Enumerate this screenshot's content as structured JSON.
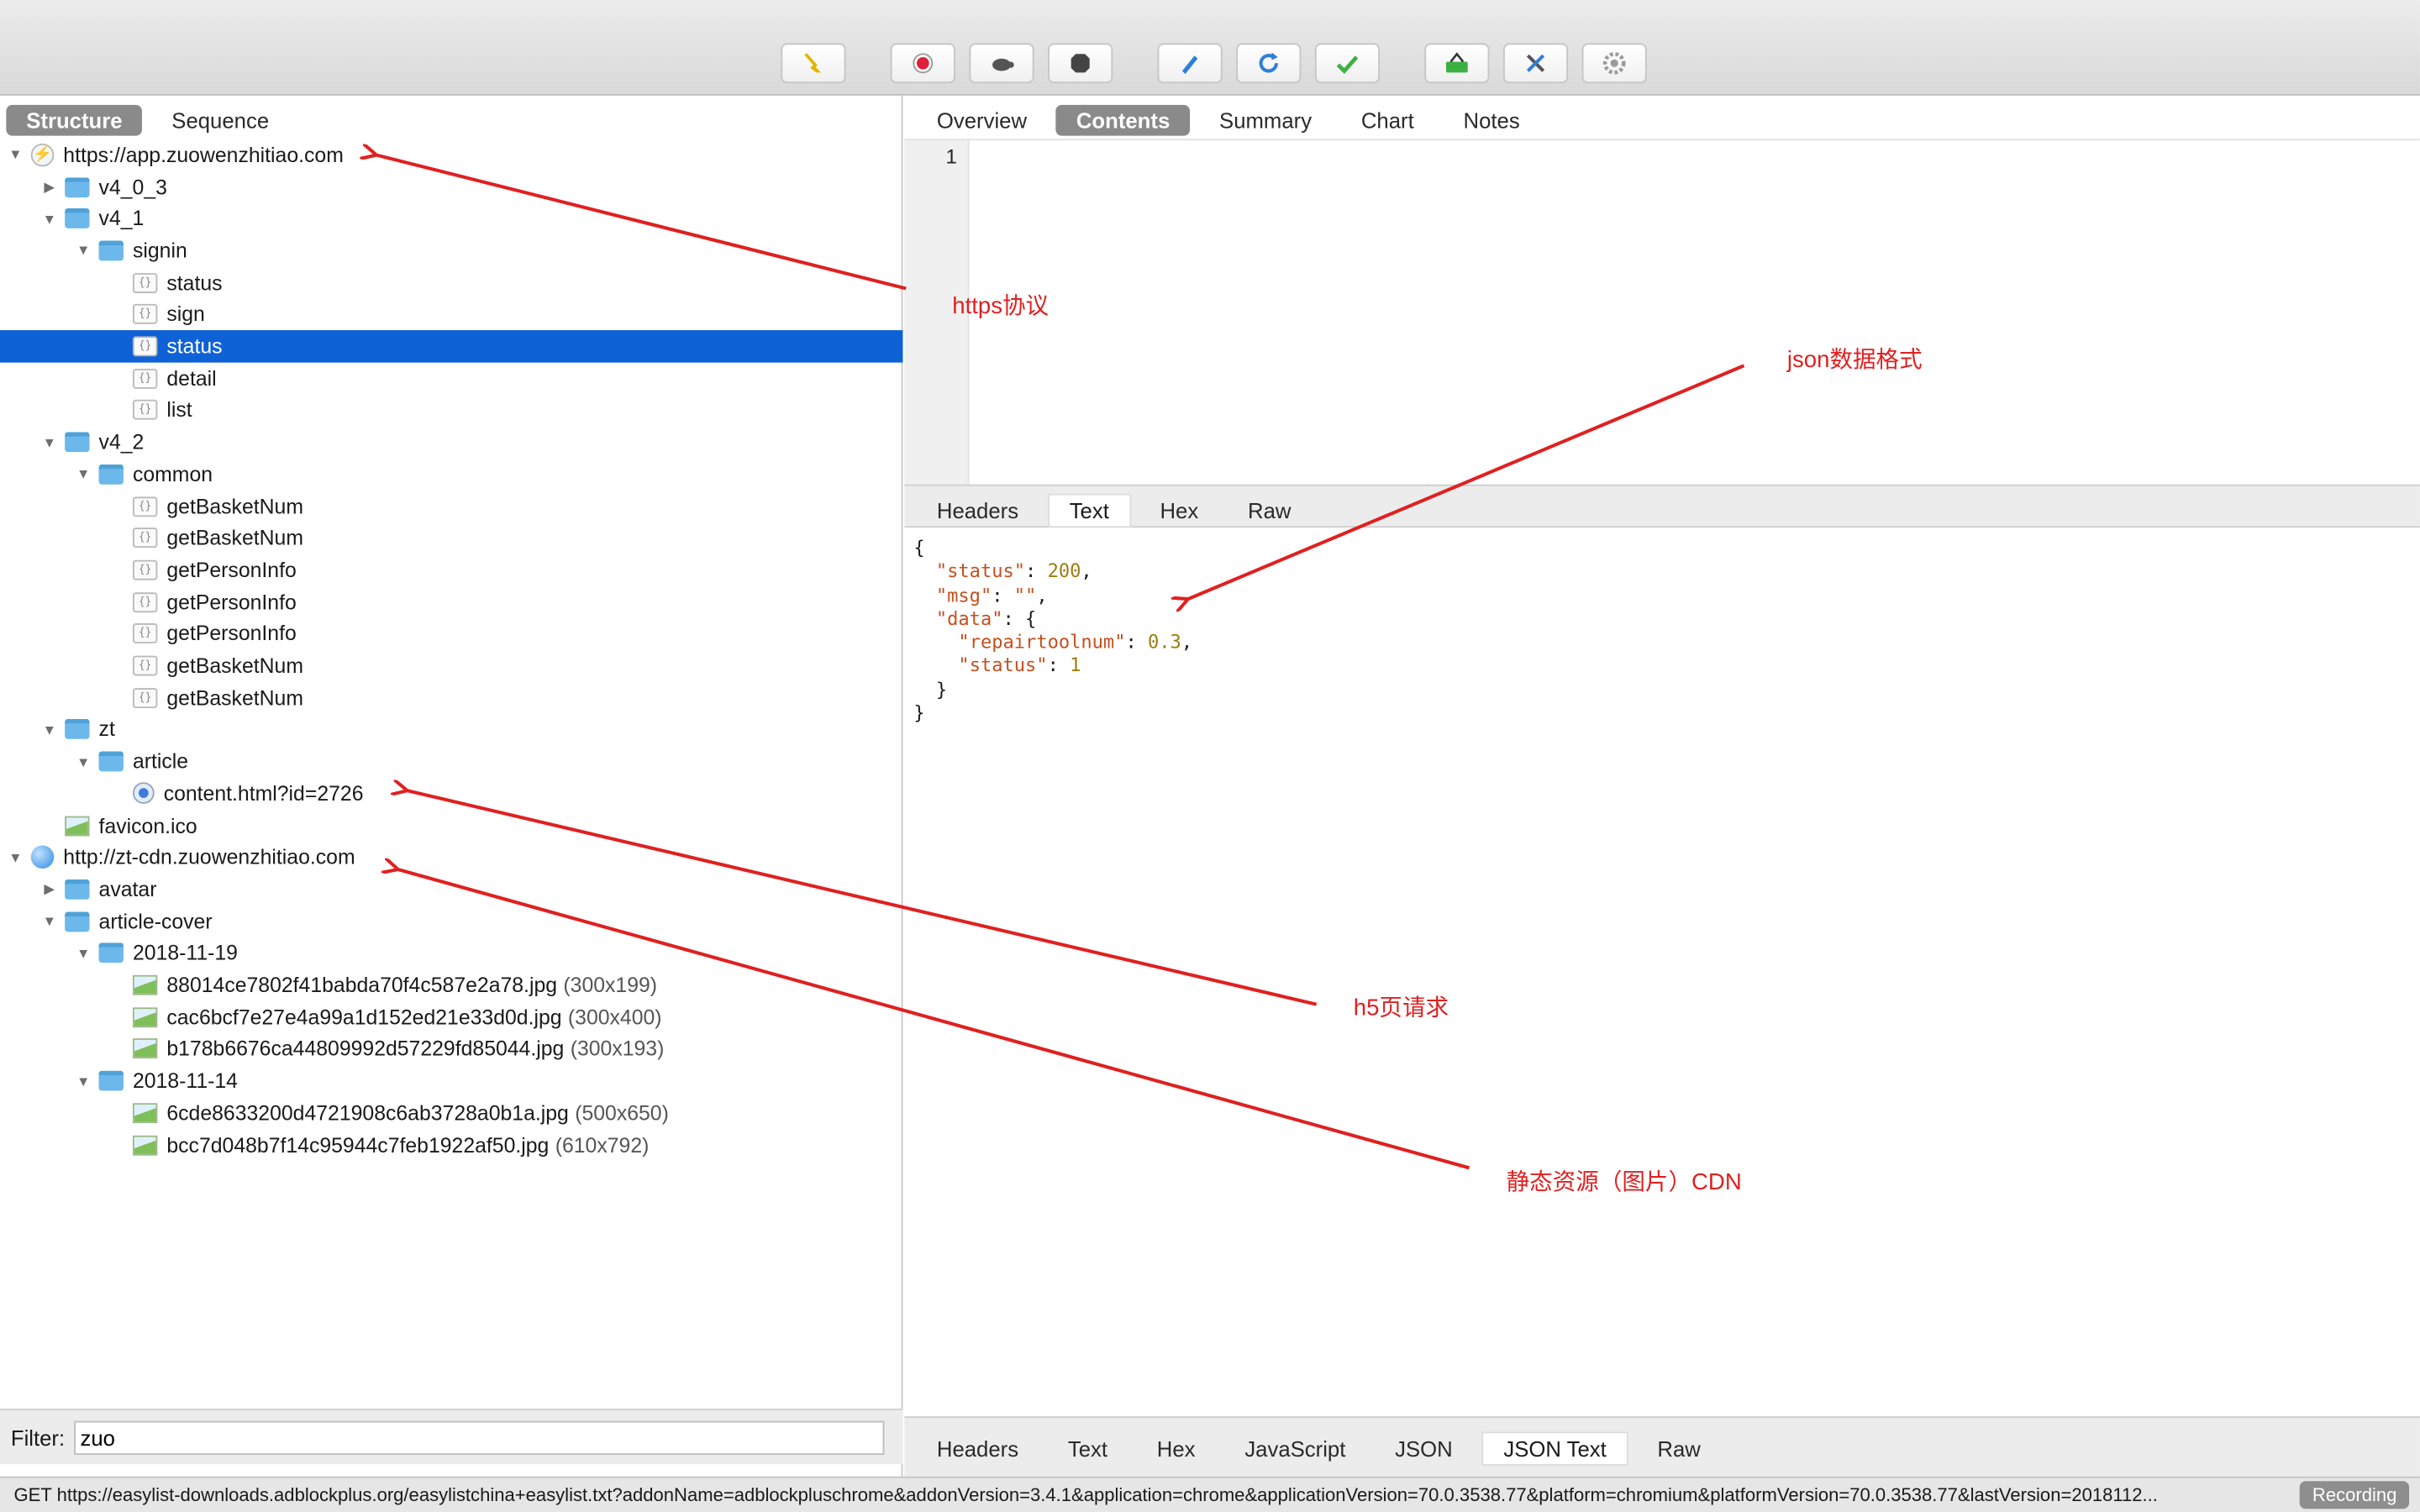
{
  "toolbar": {
    "buttons": [
      {
        "name": "broom-icon",
        "color": "#e0b400"
      },
      {
        "name": "record-icon",
        "color": "#e0203a"
      },
      {
        "name": "turtle-icon",
        "color": "#555555"
      },
      {
        "name": "stop-icon",
        "color": "#444444"
      },
      {
        "name": "pen-icon",
        "color": "#2f7fd8"
      },
      {
        "name": "refresh-icon",
        "color": "#2f7fd8"
      },
      {
        "name": "check-icon",
        "color": "#3cb043"
      },
      {
        "name": "basket-icon",
        "color": "#3cb043"
      },
      {
        "name": "tools-icon",
        "color": "#2f7fd8"
      },
      {
        "name": "gear-icon",
        "color": "#9a9a9a"
      }
    ]
  },
  "left_tabs": [
    "Structure",
    "Sequence"
  ],
  "tree": [
    {
      "depth": 0,
      "disc": "open",
      "icon": "host-https",
      "label": "https://app.zuowenzhitiao.com"
    },
    {
      "depth": 1,
      "disc": "closed",
      "icon": "folder",
      "label": "v4_0_3"
    },
    {
      "depth": 1,
      "disc": "open",
      "icon": "folder",
      "label": "v4_1"
    },
    {
      "depth": 2,
      "disc": "open",
      "icon": "folder",
      "label": "signin"
    },
    {
      "depth": 3,
      "disc": "none",
      "icon": "json",
      "label": "status"
    },
    {
      "depth": 3,
      "disc": "none",
      "icon": "json",
      "label": "sign"
    },
    {
      "depth": 3,
      "disc": "none",
      "icon": "json",
      "label": "status",
      "selected": true
    },
    {
      "depth": 3,
      "disc": "none",
      "icon": "json",
      "label": "detail"
    },
    {
      "depth": 3,
      "disc": "none",
      "icon": "json",
      "label": "list"
    },
    {
      "depth": 1,
      "disc": "open",
      "icon": "folder",
      "label": "v4_2"
    },
    {
      "depth": 2,
      "disc": "open",
      "icon": "folder",
      "label": "common"
    },
    {
      "depth": 3,
      "disc": "none",
      "icon": "json",
      "label": "getBasketNum"
    },
    {
      "depth": 3,
      "disc": "none",
      "icon": "json",
      "label": "getBasketNum"
    },
    {
      "depth": 3,
      "disc": "none",
      "icon": "json",
      "label": "getPersonInfo"
    },
    {
      "depth": 3,
      "disc": "none",
      "icon": "json",
      "label": "getPersonInfo"
    },
    {
      "depth": 3,
      "disc": "none",
      "icon": "json",
      "label": "getPersonInfo"
    },
    {
      "depth": 3,
      "disc": "none",
      "icon": "json",
      "label": "getBasketNum"
    },
    {
      "depth": 3,
      "disc": "none",
      "icon": "json",
      "label": "getBasketNum"
    },
    {
      "depth": 1,
      "disc": "open",
      "icon": "folder",
      "label": "zt"
    },
    {
      "depth": 2,
      "disc": "open",
      "icon": "folder",
      "label": "article"
    },
    {
      "depth": 3,
      "disc": "none",
      "icon": "html",
      "label": "content.html?id=2726"
    },
    {
      "depth": 1,
      "disc": "none",
      "icon": "img",
      "label": "favicon.ico"
    },
    {
      "depth": 0,
      "disc": "open",
      "icon": "host-http",
      "label": "http://zt-cdn.zuowenzhitiao.com"
    },
    {
      "depth": 1,
      "disc": "closed",
      "icon": "folder",
      "label": "avatar"
    },
    {
      "depth": 1,
      "disc": "open",
      "icon": "folder",
      "label": "article-cover"
    },
    {
      "depth": 2,
      "disc": "open",
      "icon": "folder",
      "label": "2018-11-19"
    },
    {
      "depth": 3,
      "disc": "none",
      "icon": "img",
      "label": "88014ce7802f41babda70f4c587e2a78.jpg",
      "extra": "(300x199)"
    },
    {
      "depth": 3,
      "disc": "none",
      "icon": "img",
      "label": "cac6bcf7e27e4a99a1d152ed21e33d0d.jpg",
      "extra": "(300x400)"
    },
    {
      "depth": 3,
      "disc": "none",
      "icon": "img",
      "label": "b178b6676ca44809992d57229fd85044.jpg",
      "extra": "(300x193)"
    },
    {
      "depth": 2,
      "disc": "open",
      "icon": "folder",
      "label": "2018-11-14"
    },
    {
      "depth": 3,
      "disc": "none",
      "icon": "img",
      "label": "6cde8633200d4721908c6ab3728a0b1a.jpg",
      "extra": "(500x650)"
    },
    {
      "depth": 3,
      "disc": "none",
      "icon": "img",
      "label": "bcc7d048b7f14c95944c7feb1922af50.jpg",
      "extra": "(610x792)"
    }
  ],
  "filter": {
    "label": "Filter:",
    "value": "zuo"
  },
  "top_tabs": [
    "Overview",
    "Contents",
    "Summary",
    "Chart",
    "Notes"
  ],
  "top_tabs_active": 1,
  "editor": {
    "line_number": "1"
  },
  "mid_tabs": [
    "Headers",
    "Text",
    "Hex",
    "Raw"
  ],
  "mid_tabs_active": 1,
  "json_body": [
    [
      {
        "t": "{",
        "c": ""
      }
    ],
    [
      {
        "t": "  ",
        "c": ""
      },
      {
        "t": "\"status\"",
        "c": "jk"
      },
      {
        "t": ": ",
        "c": ""
      },
      {
        "t": "200",
        "c": "jn"
      },
      {
        "t": ",",
        "c": ""
      }
    ],
    [
      {
        "t": "  ",
        "c": ""
      },
      {
        "t": "\"msg\"",
        "c": "jk"
      },
      {
        "t": ": ",
        "c": ""
      },
      {
        "t": "\"\"",
        "c": "js"
      },
      {
        "t": ",",
        "c": ""
      }
    ],
    [
      {
        "t": "  ",
        "c": ""
      },
      {
        "t": "\"data\"",
        "c": "jk"
      },
      {
        "t": ": {",
        "c": ""
      }
    ],
    [
      {
        "t": "    ",
        "c": ""
      },
      {
        "t": "\"repairtoolnum\"",
        "c": "jk"
      },
      {
        "t": ": ",
        "c": ""
      },
      {
        "t": "0.3",
        "c": "jn"
      },
      {
        "t": ",",
        "c": ""
      }
    ],
    [
      {
        "t": "    ",
        "c": ""
      },
      {
        "t": "\"status\"",
        "c": "jk"
      },
      {
        "t": ": ",
        "c": ""
      },
      {
        "t": "1",
        "c": "jn"
      }
    ],
    [
      {
        "t": "  }",
        "c": ""
      }
    ],
    [
      {
        "t": "}",
        "c": ""
      }
    ]
  ],
  "bottom_tabs": [
    "Headers",
    "Text",
    "Hex",
    "JavaScript",
    "JSON",
    "JSON Text",
    "Raw"
  ],
  "bottom_tabs_active": 5,
  "status": {
    "text": "GET https://easylist-downloads.adblockplus.org/easylistchina+easylist.txt?addonName=adblockpluschrome&addonVersion=3.4.1&application=chrome&applicationVersion=70.0.3538.77&platform=chromium&platformVersion=70.0.3538.77&lastVersion=2018112...",
    "recording": "Recording"
  },
  "annotations": [
    {
      "id": "https",
      "text": "https协议"
    },
    {
      "id": "json",
      "text": "json数据格式"
    },
    {
      "id": "h5",
      "text": "h5页请求"
    },
    {
      "id": "cdn",
      "text": "静态资源（图片）CDN"
    }
  ],
  "annotation_color": "#e02020"
}
